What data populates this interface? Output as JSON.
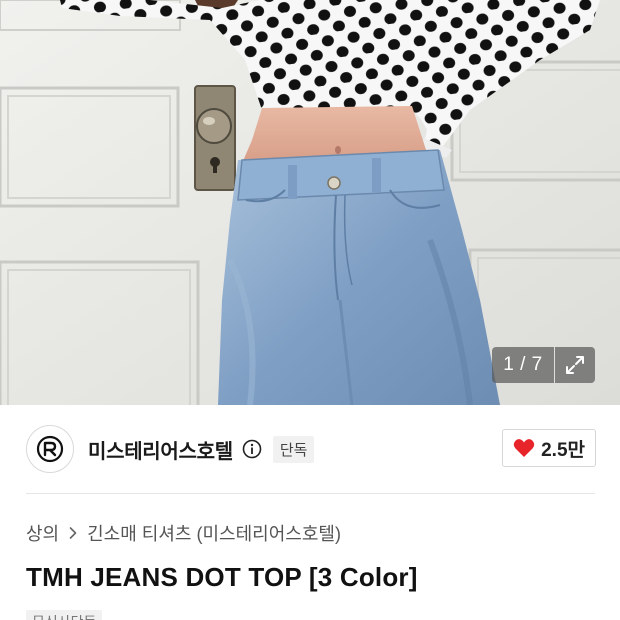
{
  "gallery": {
    "counter": "1 / 7",
    "expand_icon": "expand-arrows-icon"
  },
  "brand": {
    "logo_icon": "brand-logo-icon",
    "name": "미스테리어스호텔",
    "info_icon": "info-icon",
    "badge": "단독"
  },
  "likes": {
    "icon": "heart-icon",
    "count": "2.5만",
    "heart_color": "#e8242b"
  },
  "breadcrumb": {
    "items": [
      "상의",
      "긴소매 티셔츠 (미스테리어스호텔)"
    ],
    "separator_icon": "chevron-right-icon"
  },
  "product": {
    "title": "TMH JEANS DOT TOP [3 Color]",
    "tag": "무신사단독"
  }
}
